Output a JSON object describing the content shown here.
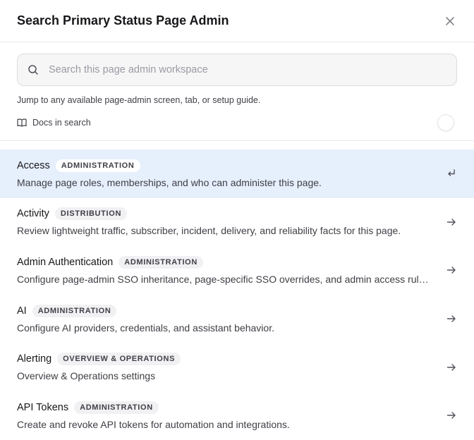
{
  "dialog": {
    "title": "Search Primary Status Page Admin"
  },
  "search": {
    "placeholder": "Search this page admin workspace",
    "value": "",
    "hint": "Jump to any available page-admin screen, tab, or setup guide."
  },
  "docs_toggle": {
    "label": "Docs in search",
    "enabled": false
  },
  "results": [
    {
      "name": "Access",
      "category": "ADMINISTRATION",
      "description": "Manage page roles, memberships, and who can administer this page.",
      "icon": "enter-icon",
      "active": true
    },
    {
      "name": "Activity",
      "category": "DISTRIBUTION",
      "description": "Review lightweight traffic, subscriber, incident, delivery, and reliability facts for this page.",
      "icon": "arrow-right-icon",
      "active": false
    },
    {
      "name": "Admin Authentication",
      "category": "ADMINISTRATION",
      "description": "Configure page-admin SSO inheritance, page-specific SSO overrides, and admin access rules.",
      "icon": "arrow-right-icon",
      "active": false
    },
    {
      "name": "AI",
      "category": "ADMINISTRATION",
      "description": "Configure AI providers, credentials, and assistant behavior.",
      "icon": "arrow-right-icon",
      "active": false
    },
    {
      "name": "Alerting",
      "category": "OVERVIEW & OPERATIONS",
      "description": "Overview & Operations settings",
      "icon": "arrow-right-icon",
      "active": false
    },
    {
      "name": "API Tokens",
      "category": "ADMINISTRATION",
      "description": "Create and revoke API tokens for automation and integrations.",
      "icon": "arrow-right-icon",
      "active": false
    }
  ],
  "colors": {
    "active_row": "#e6effc",
    "text": "#18181b",
    "muted": "#3f3f46"
  }
}
